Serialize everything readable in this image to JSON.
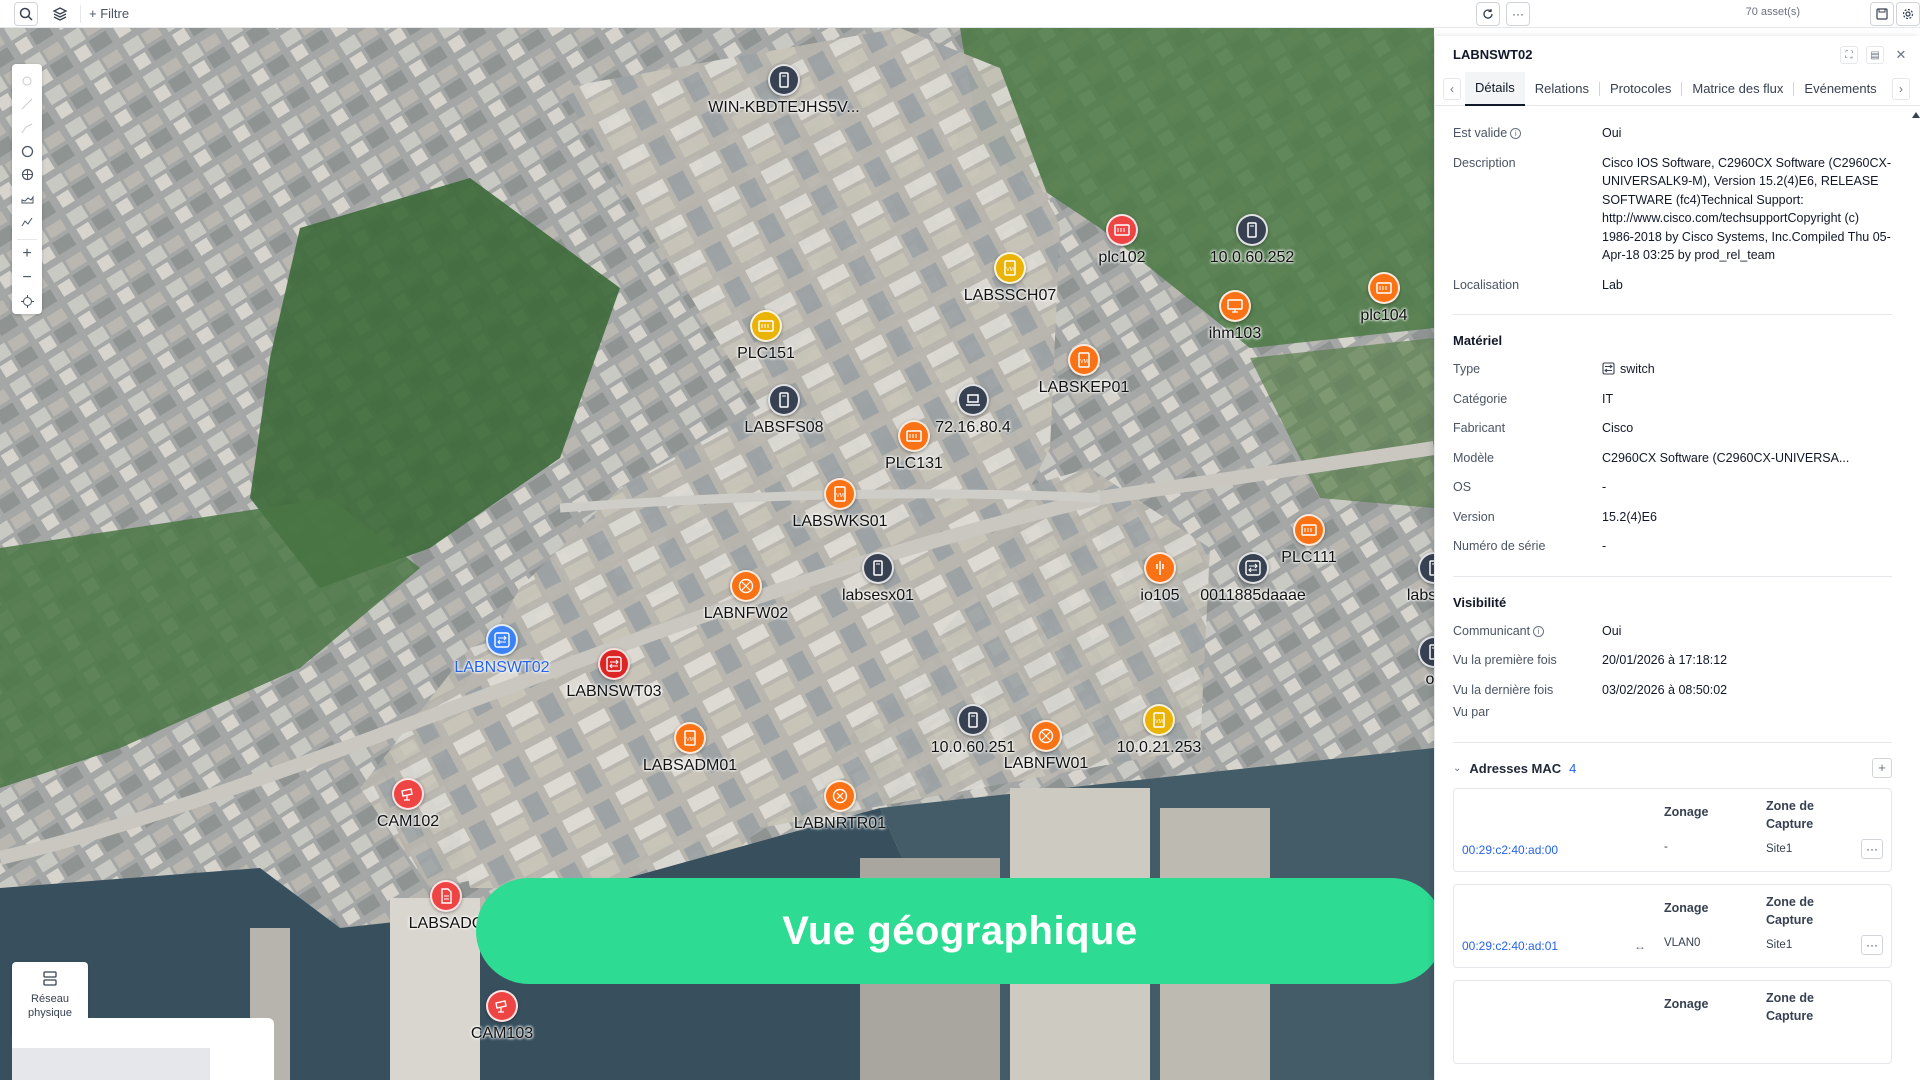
{
  "topbar": {
    "filter_label": "+ Filtre",
    "asset_count": "70 asset(s)"
  },
  "map": {
    "reseau_label_1": "Réseau",
    "reseau_label_2": "physique",
    "assets": [
      {
        "label": "WIN-KBDTEJHS5V...",
        "color": "#374151",
        "icon": "server-icon"
      },
      {
        "label": "plc102",
        "color": "#ef4444",
        "icon": "plc-icon"
      },
      {
        "label": "10.0.60.252",
        "color": "#374151",
        "icon": "server-icon"
      },
      {
        "label": "LABSSCH07",
        "color": "#eab308",
        "icon": "vm-icon"
      },
      {
        "label": "ihm103",
        "color": "#f97316",
        "icon": "hmi-icon"
      },
      {
        "label": "plc104",
        "color": "#f97316",
        "icon": "plc-icon"
      },
      {
        "label": "PLC151",
        "color": "#eab308",
        "icon": "plc-icon"
      },
      {
        "label": "LABSKEP01",
        "color": "#f97316",
        "icon": "vm-icon"
      },
      {
        "label": "LABSFS08",
        "color": "#374151",
        "icon": "server-icon"
      },
      {
        "label": "72.16.80.4",
        "color": "#374151",
        "icon": "laptop-icon"
      },
      {
        "label": "PLC131",
        "color": "#f97316",
        "icon": "plc-icon"
      },
      {
        "label": "LABSWKS01",
        "color": "#f97316",
        "icon": "vm-icon"
      },
      {
        "label": "PLC111",
        "color": "#f97316",
        "icon": "plc-icon"
      },
      {
        "label": "labsesx01",
        "color": "#374151",
        "icon": "server-icon"
      },
      {
        "label": "io105",
        "color": "#f97316",
        "icon": "io-icon"
      },
      {
        "label": "0011885daaae",
        "color": "#374151",
        "icon": "switch-icon"
      },
      {
        "label": "labscyb",
        "color": "#374151",
        "icon": "server-icon"
      },
      {
        "label": "LABNFW02",
        "color": "#f97316",
        "icon": "firewall-icon"
      },
      {
        "label": "LABNSWT02",
        "color": "#3b82f6",
        "icon": "switch-icon"
      },
      {
        "label": "LABNSWT03",
        "color": "#dc2626",
        "icon": "switch-icon"
      },
      {
        "label": "10.0.60.251",
        "color": "#374151",
        "icon": "server-icon"
      },
      {
        "label": "LABNFW01",
        "color": "#f97316",
        "icon": "firewall-icon"
      },
      {
        "label": "10.0.21.253",
        "color": "#eab308",
        "icon": "vm-icon"
      },
      {
        "label": "LABSADM01",
        "color": "#f97316",
        "icon": "vm-icon"
      },
      {
        "label": "LABNRTR01",
        "color": "#f97316",
        "icon": "router-icon"
      },
      {
        "label": "CAM102",
        "color": "#ef4444",
        "icon": "camera-icon"
      },
      {
        "label": "LABSADC",
        "color": "#ef4444",
        "icon": "doc-icon"
      },
      {
        "label": "CAM103",
        "color": "#ef4444",
        "icon": "camera-icon"
      },
      {
        "label": "oc",
        "color": "#374151",
        "icon": "server-icon"
      }
    ]
  },
  "banner": {
    "text": "Vue géographique"
  },
  "panel": {
    "title": "LABNSWT02",
    "tabs": [
      "Détails",
      "Relations",
      "Protocoles",
      "Matrice des flux",
      "Evénements"
    ],
    "details": {
      "est_valide_label": "Est valide",
      "est_valide_value": "Oui",
      "description_label": "Description",
      "description_value": "Cisco IOS Software, C2960CX Software (C2960CX-UNIVERSALK9-M), Version 15.2(4)E6, RELEASE SOFTWARE (fc4)Technical Support: http://www.cisco.com/techsupportCopyright (c) 1986-2018 by Cisco Systems, Inc.Compiled Thu 05-Apr-18 03:25 by prod_rel_team",
      "localisation_label": "Localisation",
      "localisation_value": "Lab"
    },
    "materiel": {
      "title": "Matériel",
      "type_label": "Type",
      "type_value": "switch",
      "categorie_label": "Catégorie",
      "categorie_value": "IT",
      "fabricant_label": "Fabricant",
      "fabricant_value": "Cisco",
      "modele_label": "Modèle",
      "modele_value": "C2960CX Software (C2960CX-UNIVERSA...",
      "os_label": "OS",
      "os_value": "-",
      "version_label": "Version",
      "version_value": "15.2(4)E6",
      "serie_label": "Numéro de série",
      "serie_value": "-"
    },
    "visibilite": {
      "title": "Visibilité",
      "communicant_label": "Communicant",
      "communicant_value": "Oui",
      "premiere_label": "Vu la première fois",
      "premiere_value": "20/01/2026 à 17:18:12",
      "derniere_label": "Vu la dernière fois",
      "derniere_value": "03/02/2026 à 08:50:02",
      "vupar_label": "Vu par"
    },
    "mac": {
      "title": "Adresses MAC",
      "count": "4",
      "zonage_header": "Zonage",
      "capture_header_1": "Zone de",
      "capture_header_2": "Capture",
      "cards": [
        {
          "mac": "00:29:c2:40:ad:00",
          "zonage": "-",
          "capture": "Site1",
          "arrow": ""
        },
        {
          "mac": "00:29:c2:40:ad:01",
          "zonage": "VLAN0",
          "capture": "Site1",
          "arrow": "↔"
        },
        {
          "mac": "",
          "zonage": "",
          "capture": "",
          "arrow": ""
        }
      ]
    }
  },
  "colors": {
    "banner": "#2ddc92",
    "accent": "#2563eb"
  }
}
